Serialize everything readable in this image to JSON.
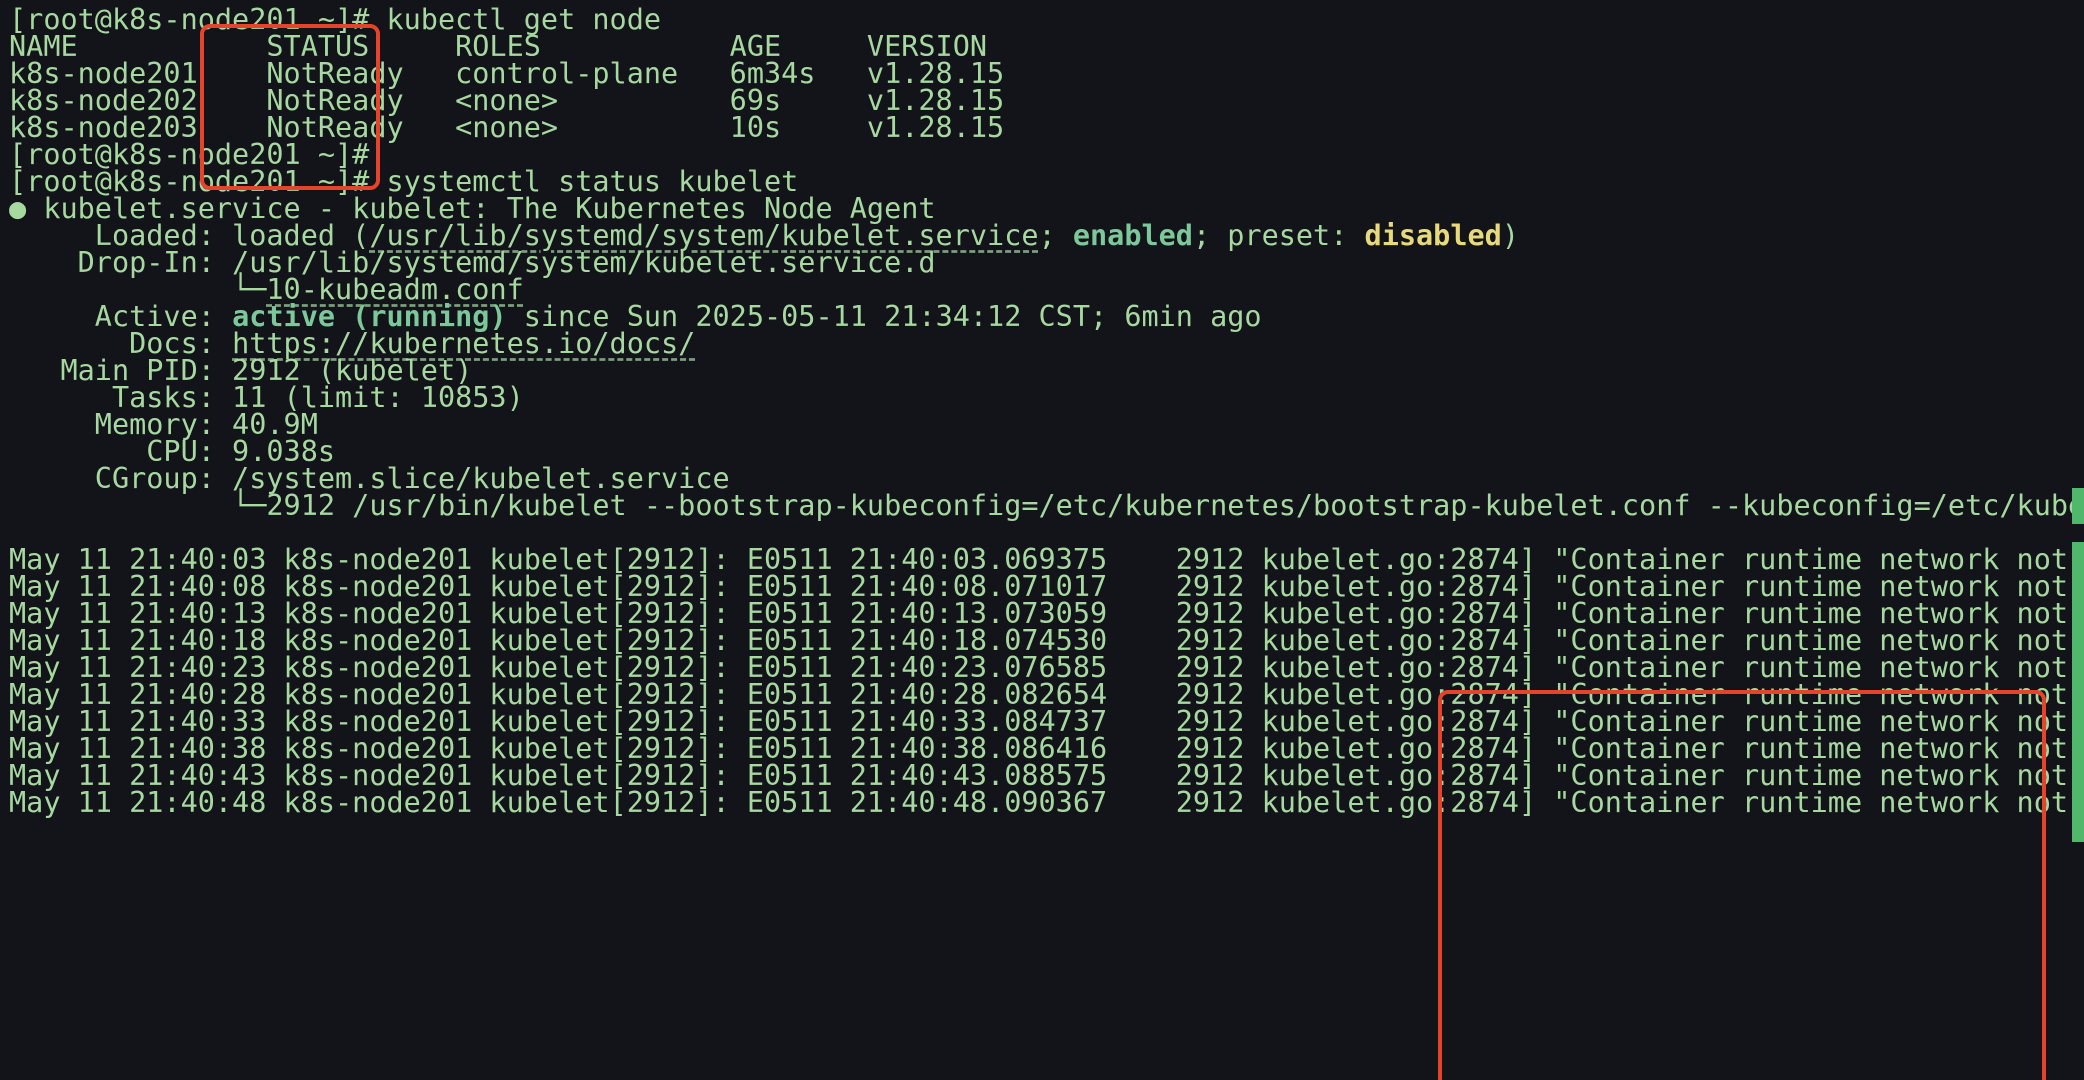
{
  "terminal": {
    "lines": {
      "l0": "[root@k8s-node201 ~]# kubectl get node",
      "l1": "NAME           STATUS     ROLES           AGE     VERSION",
      "l2": "k8s-node201    NotReady   control-plane   6m34s   v1.28.15",
      "l3": "k8s-node202    NotReady   <none>          69s     v1.28.15",
      "l4": "k8s-node203    NotReady   <none>          10s     v1.28.15",
      "l5": "[root@k8s-node201 ~]#",
      "l6": "[root@k8s-node201 ~]# systemctl status kubelet",
      "l7": "● kubelet.service - kubelet: The Kubernetes Node Agent",
      "l8_a": "     Loaded: loaded (",
      "l8_b": "/usr/lib/systemd/system/kubelet.service",
      "l8_c": "; ",
      "l8_d": "enabled",
      "l8_e": "; preset: ",
      "l8_f": "disabled",
      "l8_g": ")",
      "l9": "    Drop-In: /usr/lib/systemd/system/kubelet.service.d",
      "l10_a": "             └─",
      "l10_b": "10-kubeadm.conf",
      "l11_a": "     Active: ",
      "l11_b": "active (running)",
      "l11_c": " since Sun 2025-05-11 21:34:12 CST; 6min ago",
      "l12_a": "       Docs: ",
      "l12_b": "https://kubernetes.io/docs/",
      "l13": "   Main PID: 2912 (kubelet)",
      "l14": "      Tasks: 11 (limit: 10853)",
      "l15": "     Memory: 40.9M",
      "l16": "        CPU: 9.038s",
      "l17": "     CGroup: /system.slice/kubelet.service",
      "l18": "             └─2912 /usr/bin/kubelet --bootstrap-kubeconfig=/etc/kubernetes/bootstrap-kubelet.conf --kubeconfig=/etc/kubernetes/k"
    },
    "log_rows": [
      "May 11 21:40:03 k8s-node201 kubelet[2912]: E0511 21:40:03.069375    2912 kubelet.go:2874] \"Container runtime network not ready\" n",
      "May 11 21:40:08 k8s-node201 kubelet[2912]: E0511 21:40:08.071017    2912 kubelet.go:2874] \"Container runtime network not ready\" n",
      "May 11 21:40:13 k8s-node201 kubelet[2912]: E0511 21:40:13.073059    2912 kubelet.go:2874] \"Container runtime network not ready\" n",
      "May 11 21:40:18 k8s-node201 kubelet[2912]: E0511 21:40:18.074530    2912 kubelet.go:2874] \"Container runtime network not ready\" n",
      "May 11 21:40:23 k8s-node201 kubelet[2912]: E0511 21:40:23.076585    2912 kubelet.go:2874] \"Container runtime network not ready\" n",
      "May 11 21:40:28 k8s-node201 kubelet[2912]: E0511 21:40:28.082654    2912 kubelet.go:2874] \"Container runtime network not ready\" n",
      "May 11 21:40:33 k8s-node201 kubelet[2912]: E0511 21:40:33.084737    2912 kubelet.go:2874] \"Container runtime network not ready\" n",
      "May 11 21:40:38 k8s-node201 kubelet[2912]: E0511 21:40:38.086416    2912 kubelet.go:2874] \"Container runtime network not ready\" n",
      "May 11 21:40:43 k8s-node201 kubelet[2912]: E0511 21:40:43.088575    2912 kubelet.go:2874] \"Container runtime network not ready\" n",
      "May 11 21:40:48 k8s-node201 kubelet[2912]: E0511 21:40:48.090367    2912 kubelet.go:2874] \"Container runtime network not ready\" n"
    ],
    "truncation_marker": ">"
  },
  "colors": {
    "background": "#12141a",
    "text": "#a6d8a0",
    "enabled": "#7cc89a",
    "disabled": "#e8d97a",
    "annotation_box": "#e5442a",
    "scroll_marker": "#4fb86a"
  }
}
